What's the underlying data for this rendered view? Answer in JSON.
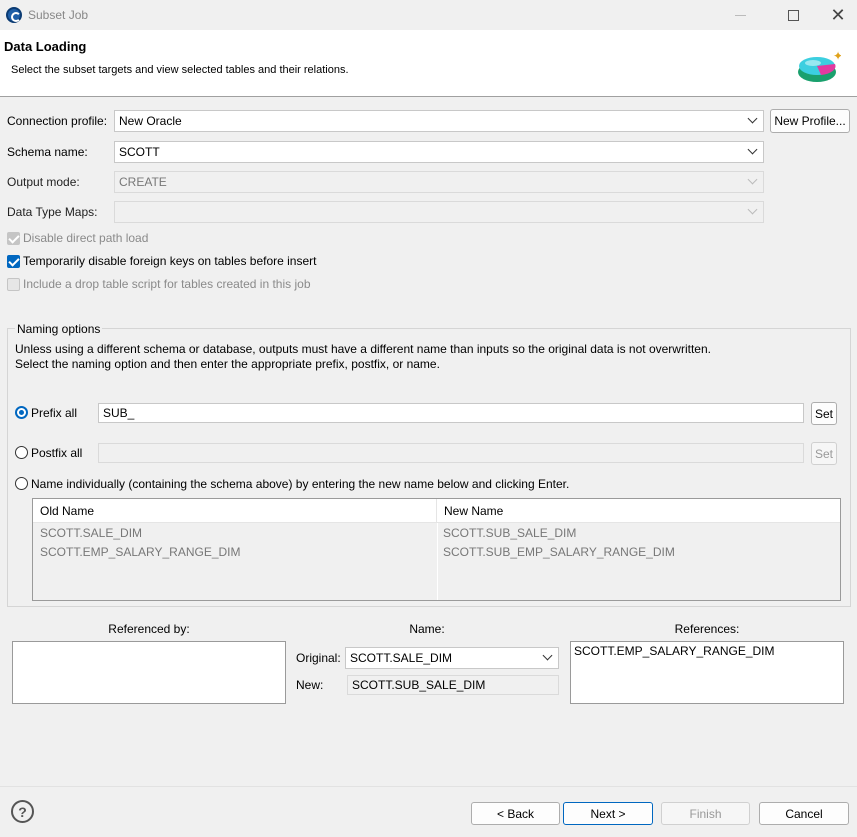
{
  "window": {
    "title": "Subset Job"
  },
  "header": {
    "title": "Data Loading",
    "description": "Select the subset targets and view selected tables and their relations."
  },
  "form": {
    "connection_label": "Connection profile:",
    "connection_value": "New Oracle",
    "new_profile_label": "New Profile...",
    "schema_label": "Schema name:",
    "schema_value": "SCOTT",
    "output_label": "Output mode:",
    "output_value": "CREATE",
    "datatype_label": "Data Type Maps:",
    "datatype_value": "",
    "checkbox_direct_path": "Disable direct path load",
    "checkbox_foreign_keys": "Temporarily disable foreign keys on tables before insert",
    "checkbox_drop_table": "Include a drop table script for tables created in this job"
  },
  "naming": {
    "title": "Naming options",
    "desc_line1": "Unless using a different schema or database, outputs must have a different name than inputs so the original data is not overwritten.",
    "desc_line2": "Select the naming option and then enter the appropriate prefix, postfix, or name.",
    "prefix_label": "Prefix all",
    "prefix_value": "SUB_",
    "postfix_label": "Postfix all",
    "postfix_value": "",
    "set_label": "Set",
    "individual_label": "Name individually (containing the schema above) by entering the new name below and clicking Enter.",
    "table": {
      "headers": [
        "Old Name",
        "New Name"
      ],
      "rows": [
        [
          "SCOTT.SALE_DIM",
          "SCOTT.SUB_SALE_DIM"
        ],
        [
          "SCOTT.EMP_SALARY_RANGE_DIM",
          "SCOTT.SUB_EMP_SALARY_RANGE_DIM"
        ]
      ]
    }
  },
  "relations": {
    "referenced_by_label": "Referenced by:",
    "name_label": "Name:",
    "references_label": "References:",
    "original_label": "Original:",
    "original_value": "SCOTT.SALE_DIM",
    "new_label": "New:",
    "new_value": "SCOTT.SUB_SALE_DIM",
    "references_items": [
      "SCOTT.EMP_SALARY_RANGE_DIM"
    ]
  },
  "footer": {
    "help": "?",
    "back": "< Back",
    "next": "Next >",
    "finish": "Finish",
    "cancel": "Cancel"
  },
  "colors": {
    "accent": "#0067c0",
    "background": "#f0f0f0"
  }
}
